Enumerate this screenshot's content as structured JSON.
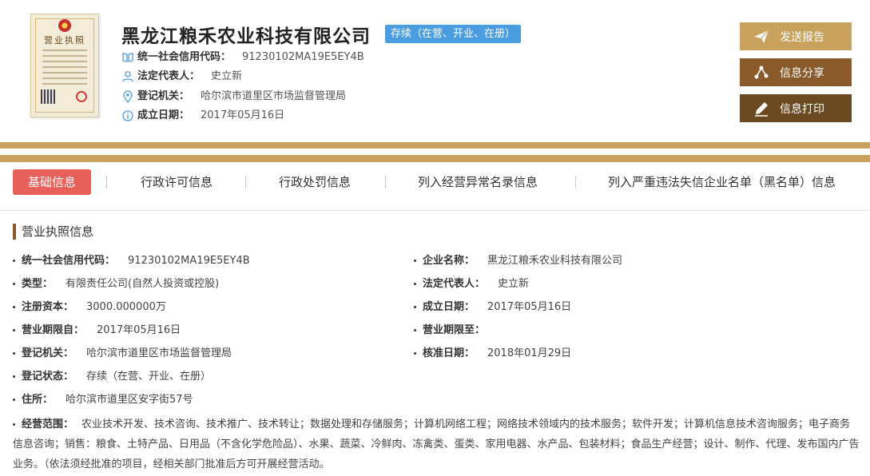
{
  "header": {
    "company_name": "黑龙江粮禾农业科技有限公司",
    "status": "存续（在营、开业、在册）",
    "license_title": "营业执照",
    "credit_code_label": "统一社会信用代码：",
    "credit_code": "91230102MA19E5EY4B",
    "legal_rep_label": "法定代表人：",
    "legal_rep": "史立新",
    "authority_label": "登记机关：",
    "authority": "哈尔滨市道里区市场监督管理局",
    "found_date_label": "成立日期：",
    "found_date": "2017年05月16日"
  },
  "actions": {
    "report": "发送报告",
    "share": "信息分享",
    "print": "信息打印"
  },
  "tabs": [
    {
      "label": "基础信息",
      "active": true
    },
    {
      "label": "行政许可信息"
    },
    {
      "label": "行政处罚信息"
    },
    {
      "label": "列入经营异常名录信息"
    },
    {
      "label": "列入严重违法失信企业名单（黑名单）信息"
    }
  ],
  "section": {
    "title": "营业执照信息"
  },
  "fields": {
    "credit_code": {
      "label": "统一社会信用代码：",
      "value": "91230102MA19E5EY4B"
    },
    "company_name": {
      "label": "企业名称：",
      "value": "黑龙江粮禾农业科技有限公司"
    },
    "type": {
      "label": "类型：",
      "value": "有限责任公司(自然人投资或控股)"
    },
    "legal_rep": {
      "label": "法定代表人：",
      "value": "史立新"
    },
    "capital": {
      "label": "注册资本：",
      "value": "3000.000000万"
    },
    "found_date": {
      "label": "成立日期：",
      "value": "2017年05月16日"
    },
    "term_from": {
      "label": "营业期限自：",
      "value": "2017年05月16日"
    },
    "term_to": {
      "label": "营业期限至：",
      "value": ""
    },
    "authority": {
      "label": "登记机关：",
      "value": "哈尔滨市道里区市场监督管理局"
    },
    "approve_date": {
      "label": "核准日期：",
      "value": "2018年01月29日"
    },
    "reg_status": {
      "label": "登记状态：",
      "value": "存续（在营、开业、在册）"
    },
    "address": {
      "label": "住所：",
      "value": "哈尔滨市道里区安字街57号"
    },
    "scope": {
      "label": "经营范围：",
      "value": "农业技术开发、技术咨询、技术推广、技术转让；数据处理和存储服务；计算机网络工程；网络技术领域内的技术服务；软件开发；计算机信息技术咨询服务；电子商务信息咨询；销售：粮食、土特产品、日用品（不含化学危险品）、水果、蔬菜、冷鲜肉、冻禽类、蛋类、家用电器、水产品、包装材料；食品生产经营；设计、制作、代理、发布国内广告业务。（依法须经批准的项目，经相关部门批准后方可开展经营活动。"
    }
  },
  "colors": {
    "gold": "#c8a15c",
    "brown": "#8a5a2a",
    "dark_brown": "#6b4a22",
    "tab_active": "#e8605a",
    "badge": "#4a9de0"
  }
}
